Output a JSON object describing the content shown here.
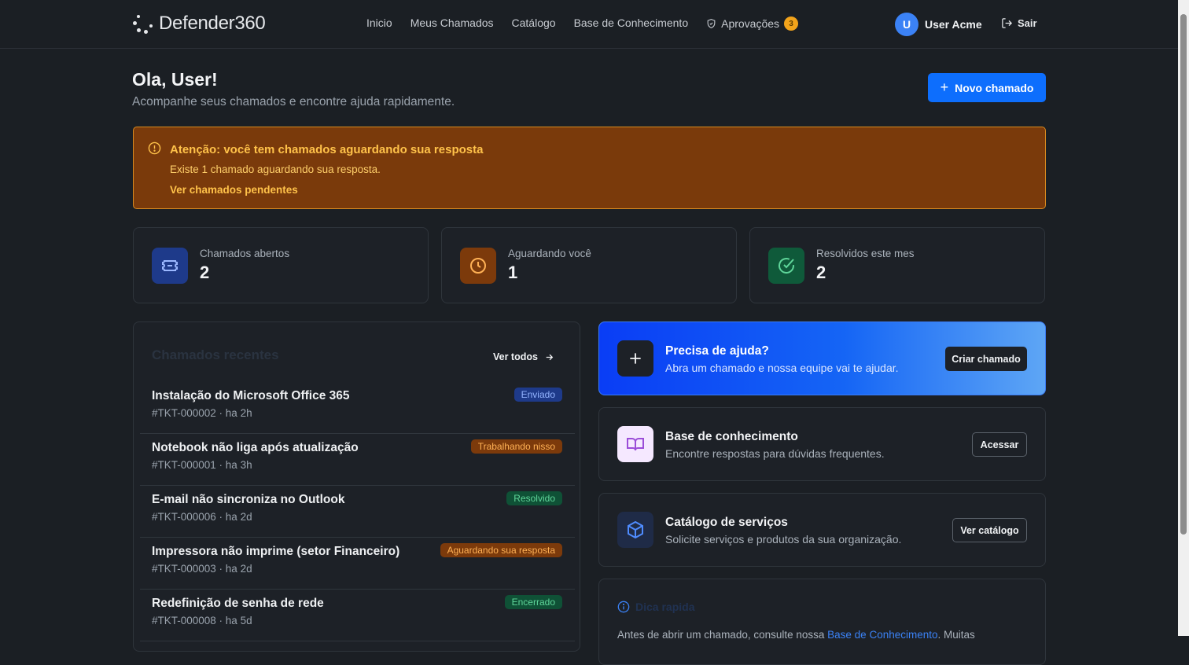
{
  "header": {
    "logo_text": "Defender360",
    "nav": [
      "Inicio",
      "Meus Chamados",
      "Catálogo",
      "Base de Conhecimento",
      "Aprovações"
    ],
    "approvals_count": "3",
    "user_initial": "U",
    "user_name": "User Acme",
    "logout_label": "Sair"
  },
  "greeting": {
    "title": "Ola, User!",
    "subtitle": "Acompanhe seus chamados e encontre ajuda rapidamente.",
    "new_ticket_label": "Novo chamado"
  },
  "alert": {
    "title": "Atenção: você tem chamados aguardando sua resposta",
    "description": "Existe 1 chamado aguardando sua resposta.",
    "link": "Ver chamados pendentes"
  },
  "stats": [
    {
      "label": "Chamados abertos",
      "value": "2",
      "color": "#1e3a8a",
      "icon": "ticket-icon"
    },
    {
      "label": "Aguardando você",
      "value": "1",
      "color": "#7c3a0b",
      "icon": "clock-icon"
    },
    {
      "label": "Resolvidos este mes",
      "value": "2",
      "color": "#0f5a3a",
      "icon": "check-circle-icon"
    }
  ],
  "recent": {
    "title": "Chamados recentes",
    "see_all": "Ver todos",
    "tickets": [
      {
        "title": "Instalação do Microsoft Office 365",
        "meta": "#TKT-000002 · ha 2h",
        "status": "Enviado",
        "bg": "#1e3a8a",
        "fg": "#93b4ff"
      },
      {
        "title": "Notebook não liga após atualização",
        "meta": "#TKT-000001 · ha 3h",
        "status": "Trabalhando nisso",
        "bg": "#7c3a0b",
        "fg": "#ffb155"
      },
      {
        "title": "E-mail não sincroniza no Outlook",
        "meta": "#TKT-000006 · ha 2d",
        "status": "Resolvido",
        "bg": "#0f5136",
        "fg": "#5fd69a"
      },
      {
        "title": "Impressora não imprime (setor Financeiro)",
        "meta": "#TKT-000003 · ha 2d",
        "status": "Aguardando sua resposta",
        "bg": "#7c3a0b",
        "fg": "#ffb155"
      },
      {
        "title": "Redefinição de senha de rede",
        "meta": "#TKT-000008 · ha 5d",
        "status": "Encerrado",
        "bg": "#0f5136",
        "fg": "#5fd69a"
      }
    ]
  },
  "help": {
    "title": "Precisa de ajuda?",
    "desc": "Abra um chamado e nossa equipe vai te ajudar.",
    "button": "Criar chamado"
  },
  "kb": {
    "title": "Base de conhecimento",
    "desc": "Encontre respostas para dúvidas frequentes.",
    "button": "Acessar"
  },
  "catalog": {
    "title": "Catálogo de serviços",
    "desc": "Solicite serviços e produtos da sua organização.",
    "button": "Ver catálogo"
  },
  "tip": {
    "title": "Dica rapida",
    "text_before": "Antes de abrir um chamado, consulte nossa ",
    "link": "Base de Conhecimento",
    "text_after": ". Muitas"
  }
}
